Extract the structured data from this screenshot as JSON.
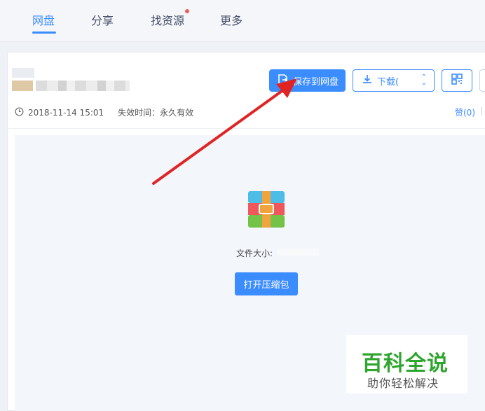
{
  "nav": {
    "tabs": [
      {
        "label": "网盘",
        "active": true
      },
      {
        "label": "分享",
        "active": false
      },
      {
        "label": "找资源",
        "active": false,
        "badge": "red-dot"
      },
      {
        "label": "更多",
        "active": false
      }
    ]
  },
  "toolbar": {
    "save_label": "保存到网盘",
    "download_label": "下载(",
    "qr_icon": "qrcode-icon"
  },
  "meta": {
    "created": "2018-11-14 15:01",
    "expiry": "失效时间：永久有效",
    "like": "赞(0)"
  },
  "preview": {
    "file_label": "文件大小:",
    "open_button": "打开压缩包"
  },
  "watermark": {
    "title": "百科全说",
    "subtitle": "助你轻松解决"
  },
  "colors": {
    "accent": "#3b8cff",
    "annotation": "#e02424",
    "watermark": "#2fa52f"
  }
}
